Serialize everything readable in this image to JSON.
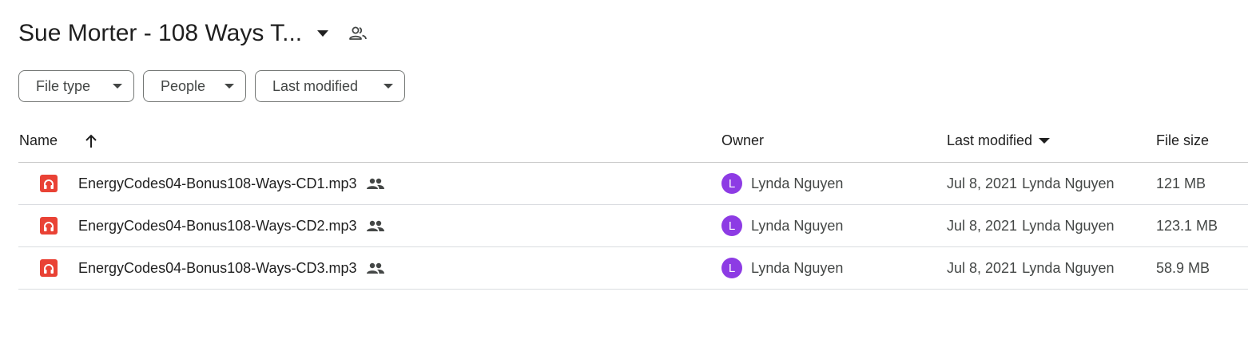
{
  "header": {
    "folder_title": "Sue Morter - 108 Ways T...",
    "title_dropdown_icon": "arrow-drop-down-icon",
    "shared_icon": "people-icon"
  },
  "filters": [
    {
      "label": "File type",
      "icon": "arrow-drop-down-icon"
    },
    {
      "label": "People",
      "icon": "arrow-drop-down-icon"
    },
    {
      "label": "Last modified",
      "icon": "arrow-drop-down-icon"
    }
  ],
  "table": {
    "columns": {
      "name": "Name",
      "owner": "Owner",
      "last_modified": "Last modified",
      "file_size": "File size"
    },
    "sort_icon": "arrow-upward-icon",
    "sorted_column_icon": "arrow-drop-down-icon",
    "rows": [
      {
        "file_icon": "audio-file-icon",
        "name": "EnergyCodes04-Bonus108-Ways-CD1.mp3",
        "shared_icon": "people-icon",
        "owner_initial": "L",
        "owner": "Lynda Nguyen",
        "date": "Jul 8, 2021",
        "modified_by": "Lynda Nguyen",
        "size": "121 MB"
      },
      {
        "file_icon": "audio-file-icon",
        "name": "EnergyCodes04-Bonus108-Ways-CD2.mp3",
        "shared_icon": "people-icon",
        "owner_initial": "L",
        "owner": "Lynda Nguyen",
        "date": "Jul 8, 2021",
        "modified_by": "Lynda Nguyen",
        "size": "123.1 MB"
      },
      {
        "file_icon": "audio-file-icon",
        "name": "EnergyCodes04-Bonus108-Ways-CD3.mp3",
        "shared_icon": "people-icon",
        "owner_initial": "L",
        "owner": "Lynda Nguyen",
        "date": "Jul 8, 2021",
        "modified_by": "Lynda Nguyen",
        "size": "58.9 MB"
      }
    ]
  },
  "colors": {
    "avatar_bg": "#8d3be4",
    "audio_icon_bg": "#e94235",
    "chip_border": "#747775",
    "row_divider": "#dadce0"
  }
}
